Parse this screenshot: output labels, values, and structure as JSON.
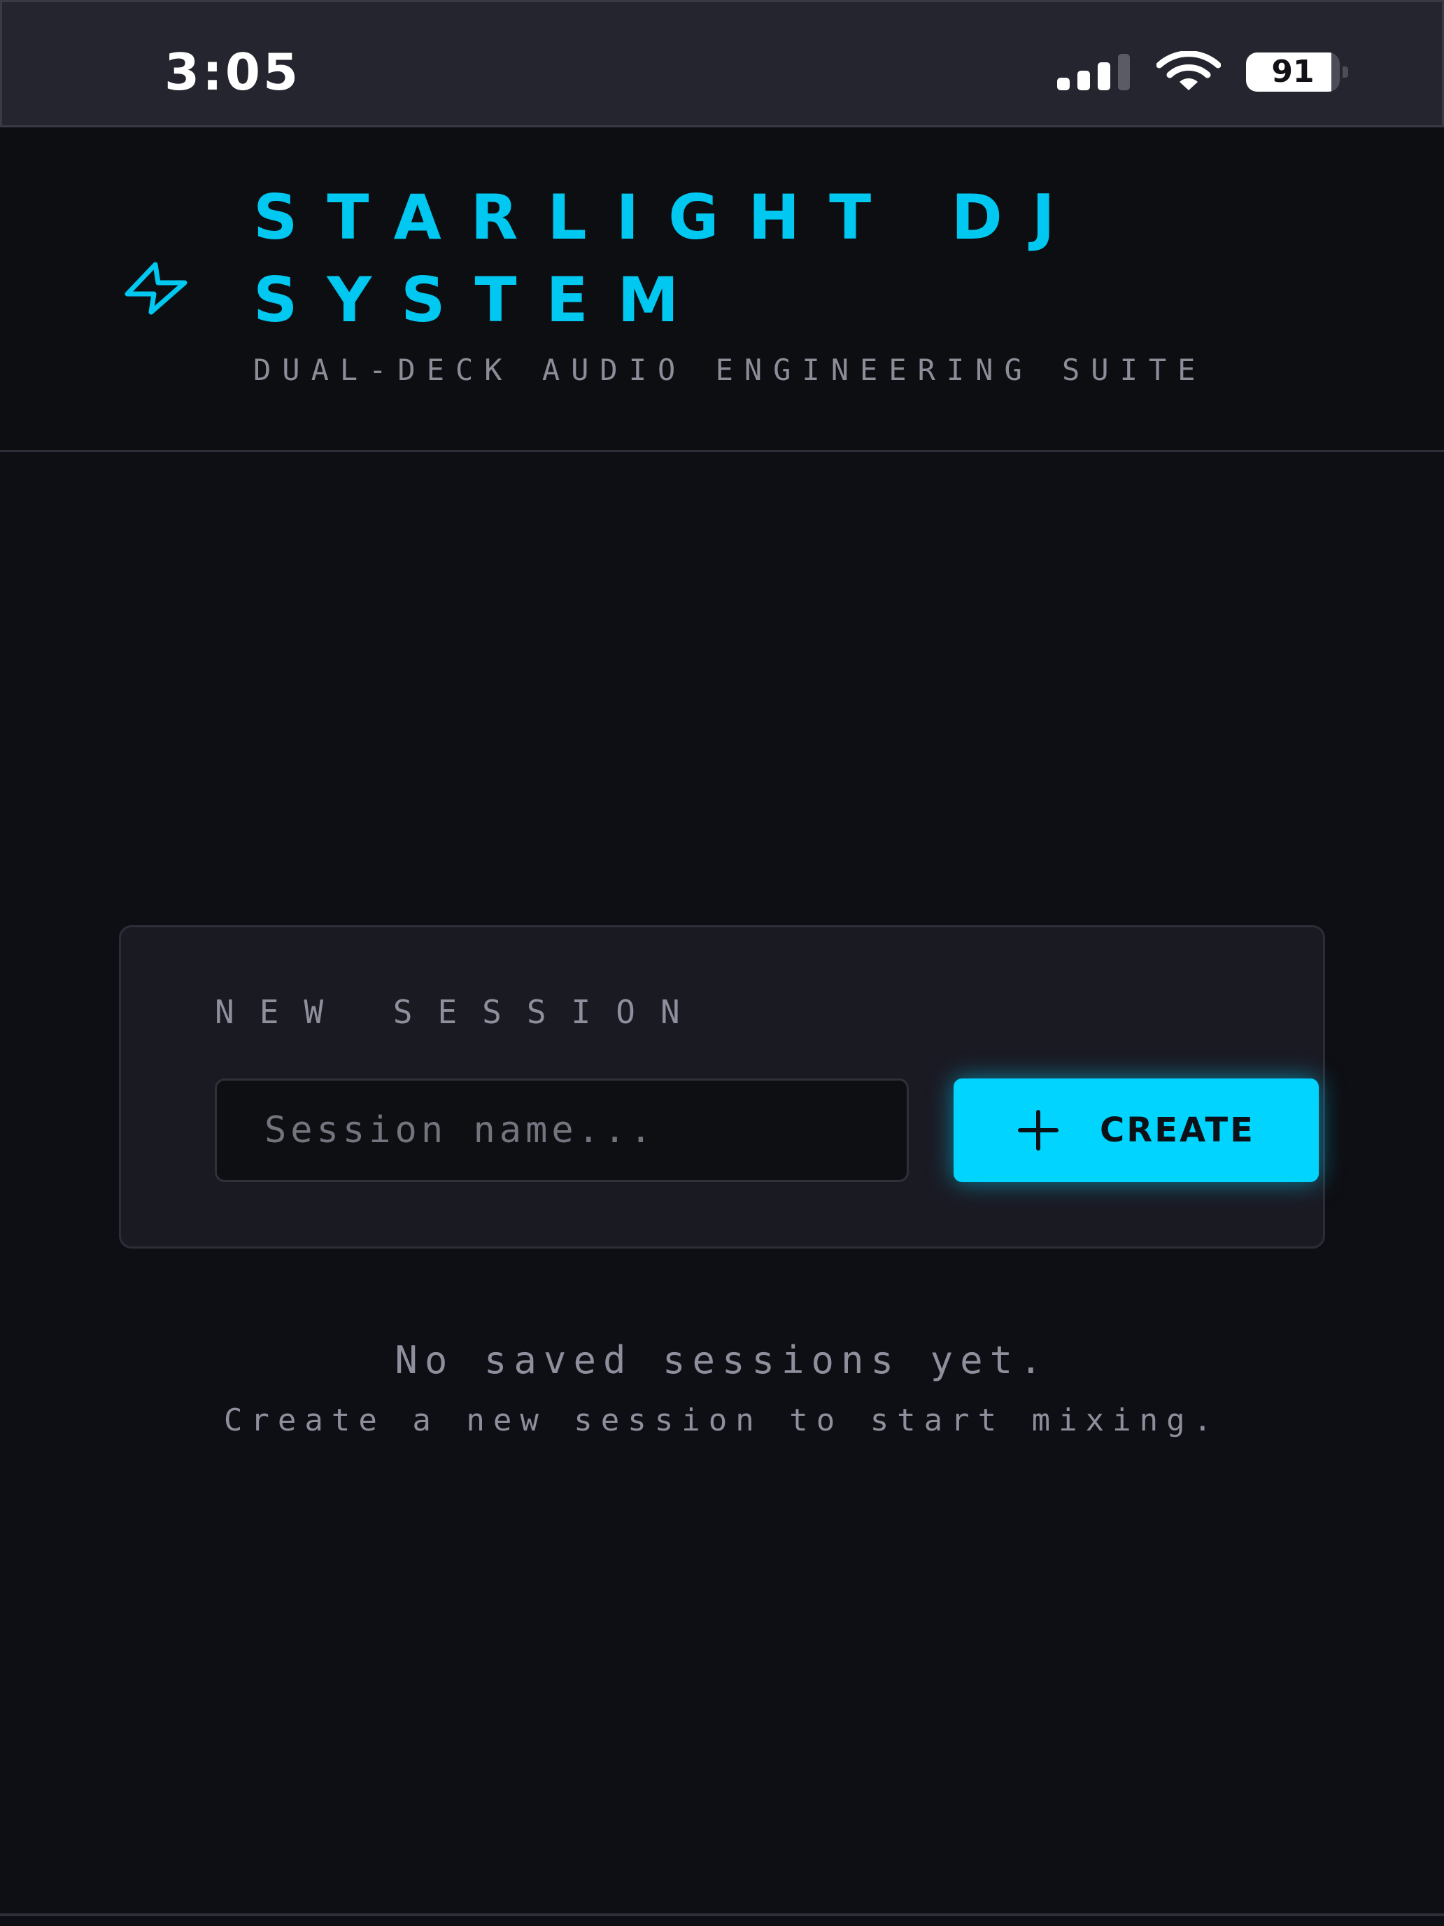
{
  "status_bar": {
    "time": "3:05",
    "battery_level": "91",
    "battery_fraction": 0.91,
    "icons": [
      "signal-icon",
      "wifi-icon",
      "battery-icon"
    ]
  },
  "header": {
    "title": "STARLIGHT DJ SYSTEM",
    "subtitle": "DUAL-DECK AUDIO ENGINEERING SUITE",
    "icon": "lightning-bolt-icon"
  },
  "new_session": {
    "heading": "NEW SESSION",
    "input_value": "",
    "input_placeholder": "Session name...",
    "create_label": "CREATE",
    "create_icon": "plus-icon"
  },
  "empty_state": {
    "title": "No saved sessions yet.",
    "subtitle": "Create a new session to start mixing."
  },
  "colors": {
    "accent": "#00d4ff",
    "background": "#0e0f14",
    "status_bar": "#25252f",
    "card": "#1a1a23",
    "muted_text": "#8f8e9c"
  }
}
